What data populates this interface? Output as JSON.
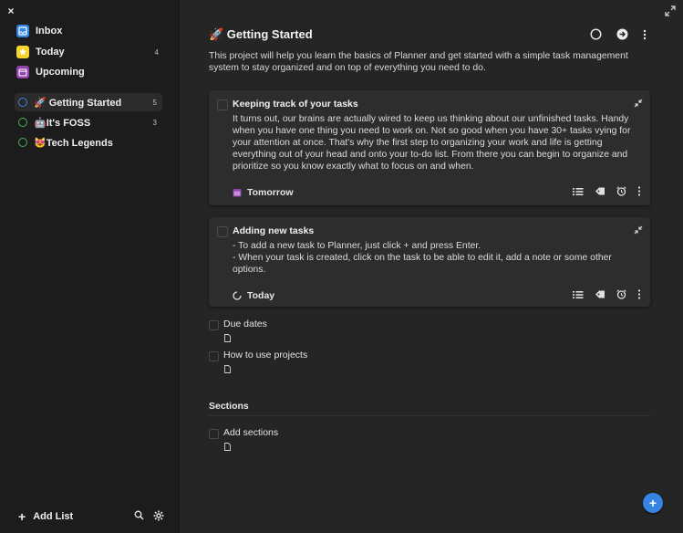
{
  "window": {
    "close_label": "×"
  },
  "sidebar": {
    "nav": [
      {
        "label": "Inbox",
        "count": "",
        "icon": "inbox-icon",
        "color": "#3584e4"
      },
      {
        "label": "Today",
        "count": "4",
        "icon": "star-icon",
        "color": "#f6d32d"
      },
      {
        "label": "Upcoming",
        "count": "",
        "icon": "calendar-icon",
        "color": "#9141ac"
      }
    ],
    "projects": [
      {
        "label": "🚀 Getting Started",
        "count": "5",
        "color": "#3584e4"
      },
      {
        "label": "🤖It's FOSS",
        "count": "3",
        "color": "#4caf50"
      },
      {
        "label": "😻Tech Legends",
        "count": "",
        "color": "#4caf50"
      }
    ],
    "footer": {
      "add_list": "Add List"
    }
  },
  "main": {
    "title": "🚀 Getting Started",
    "description": "This project will help you learn the basics of Planner and get started with a simple task management system to stay organized and on top of everything you need to do.",
    "cards": [
      {
        "title": "Keeping track of your tasks",
        "body": "It turns out, our brains are actually wired to keep us thinking about our unfinished tasks. Handy when you have one thing you need to work on. Not so good when you have 30+ tasks vying for your attention at once. That's why the first step to organizing your work and life is getting everything out of your head and onto your to-do list. From there you can begin to organize and prioritize so you know exactly what to focus on and when.",
        "due": "Tomorrow"
      },
      {
        "title": "Adding new tasks",
        "body": "- To add a new task to Planner, just click + and press Enter.\n- When your task is created, click on the task to be able to edit it, add a note or some other options.",
        "due": "Today"
      }
    ],
    "tasks": [
      {
        "label": "Due dates"
      },
      {
        "label": "How to use projects"
      }
    ],
    "section": {
      "title": "Sections",
      "tasks": [
        {
          "label": "Add sections"
        }
      ]
    },
    "fab_label": "+"
  }
}
